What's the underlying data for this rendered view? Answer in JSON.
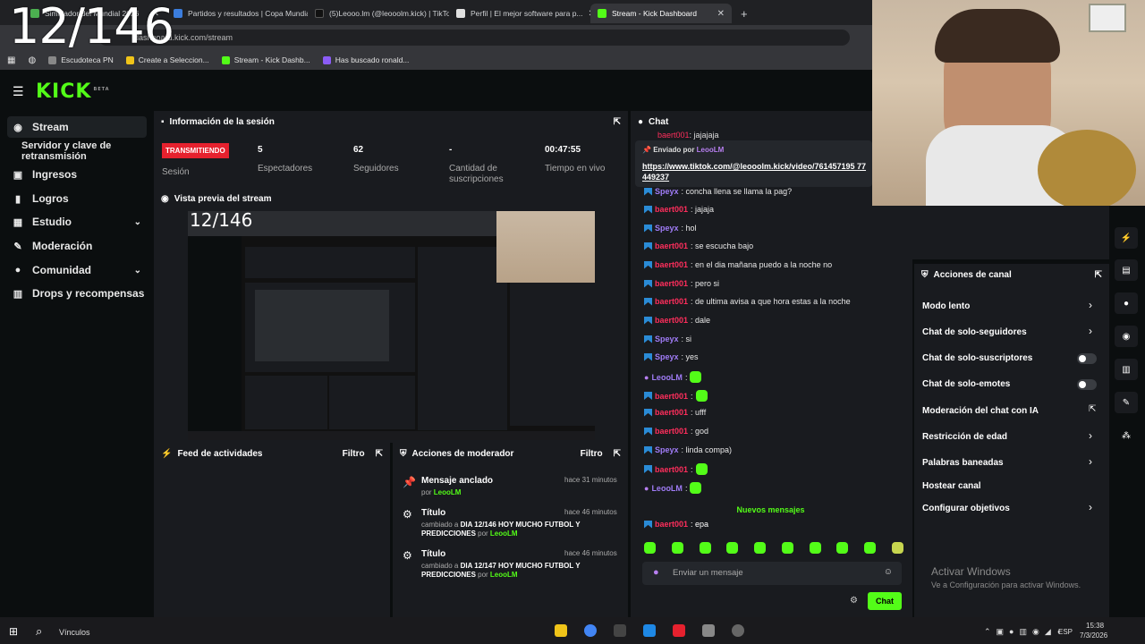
{
  "overlay": {
    "counter": "12/146"
  },
  "browser": {
    "tabs": [
      {
        "label": "Simulador del Mundial 2026",
        "color": "#4caf50"
      },
      {
        "label": "Partidos y resultados | Copa Mundial",
        "color": "#3b7ddd"
      },
      {
        "label": "(5)Leooo.lm (@leooolm.kick) | TikTok",
        "color": "#111111"
      },
      {
        "label": "Perfil | El mejor software para p...",
        "color": "#e0e0e0"
      },
      {
        "label": "Stream - Kick Dashboard",
        "color": "#53fc18"
      }
    ],
    "new_tab": "+",
    "close": "✕",
    "address": "dashboard.kick.com/stream",
    "bookmarks": [
      {
        "label": "Escudoteca PN",
        "color": "#888888"
      },
      {
        "label": "Create a Seleccion...",
        "color": "#f0c419"
      },
      {
        "label": "Stream - Kick Dashb...",
        "color": "#53fc18"
      },
      {
        "label": "Has buscado ronald...",
        "color": "#8b5cf6"
      }
    ]
  },
  "kick": {
    "logo": "KICK",
    "logo_sup": "BETA",
    "sidebar": [
      {
        "label": "Stream",
        "icon": "dot-icon",
        "glyph": "((·))"
      },
      {
        "label": "Servidor y clave de retransmisión",
        "icon": "",
        "glyph": ""
      },
      {
        "label": "Ingresos",
        "icon": "wallet-icon",
        "glyph": "▪"
      },
      {
        "label": "Logros",
        "icon": "chart-icon",
        "glyph": "▮"
      },
      {
        "label": "Estudio",
        "icon": "grid-icon",
        "glyph": "▦"
      },
      {
        "label": "Moderación",
        "icon": "wrench-icon",
        "glyph": "✎"
      },
      {
        "label": "Comunidad",
        "icon": "people-icon",
        "glyph": "●"
      },
      {
        "label": "Drops y recompensas",
        "icon": "gift-icon",
        "glyph": "▥"
      }
    ],
    "session": {
      "title": "Información de la sesión",
      "badge": "TRANSMITIENDO",
      "labels": [
        "Sesión",
        "Espectadores",
        "Seguidores",
        "Cantidad de suscripciones",
        "Tiempo en vivo"
      ],
      "values": [
        "5",
        "62",
        "-",
        "00:47:55"
      ]
    },
    "preview": {
      "title": "Vista previa del stream",
      "counter": "12/146"
    },
    "activity": {
      "title": "Feed de actividades",
      "filter": "Filtro"
    },
    "mod_actions": {
      "title": "Acciones de moderador",
      "filter": "Filtro",
      "items": [
        {
          "title": "Mensaje anclado",
          "by": "por",
          "user": "LeooLM",
          "detail": "",
          "time": "hace 31 minutos"
        },
        {
          "title": "Título",
          "by": "cambiado a",
          "user": "LeooLM",
          "detail": "DIA 12/146 HOY MUCHO FUTBOL Y PREDICCIONES",
          "time": "hace 46 minutos"
        },
        {
          "title": "Título",
          "by": "cambiado a",
          "user": "LeooLM",
          "detail": "DIA 12/147 HOY MUCHO FUTBOL Y PREDICCIONES",
          "time": "hace 46 minutos"
        }
      ]
    },
    "chat": {
      "title": "Chat",
      "pinned_by_label": "Enviado por",
      "pinned_user": "LeooLM",
      "pinned_link": "https://www.tiktok.com/@leooolm.kick/video/761457195 77449237",
      "first_line": ": jajajaja",
      "messages": [
        {
          "user": "Speyx",
          "text": ": concha llena se llama la pag?"
        },
        {
          "user": "baert001",
          "text": ": jajaja"
        },
        {
          "user": "Speyx",
          "text": ": hol"
        },
        {
          "user": "baert001",
          "text": ": se escucha bajo"
        },
        {
          "user": "baert001",
          "text": ": en el dia mañana puedo a la noche no"
        },
        {
          "user": "baert001",
          "text": ": pero si"
        },
        {
          "user": "baert001",
          "text": ": de ultima avisa a que hora estas a la noche"
        },
        {
          "user": "baert001",
          "text": ": dale"
        },
        {
          "user": "Speyx",
          "text": ": si"
        },
        {
          "user": "Speyx",
          "text": ": yes"
        },
        {
          "user": "LeooLM",
          "text": ":"
        },
        {
          "user": "baert001",
          "text": ":"
        },
        {
          "user": "baert001",
          "text": ": ufff"
        },
        {
          "user": "baert001",
          "text": ": god"
        },
        {
          "user": "Speyx",
          "text": ": linda compa)"
        },
        {
          "user": "baert001",
          "text": ":"
        },
        {
          "user": "LeooLM",
          "text": ":"
        }
      ],
      "new_messages": "Nuevos mensajes",
      "last": {
        "user": "baert001",
        "text": ": epa"
      },
      "input_placeholder": "Enviar un mensaje",
      "send": "Chat"
    },
    "channel_actions": {
      "title": "Acciones de canal",
      "items": [
        {
          "label": "Modo lento",
          "control": "chevron"
        },
        {
          "label": "Chat de solo-seguidores",
          "control": "chevron"
        },
        {
          "label": "Chat de solo-suscriptores",
          "control": "toggle"
        },
        {
          "label": "Chat de solo-emotes",
          "control": "toggle"
        },
        {
          "label": "Moderación del chat con IA",
          "control": "external"
        },
        {
          "label": "Restricción de edad",
          "control": "chevron"
        },
        {
          "label": "Palabras baneadas",
          "control": "chevron"
        },
        {
          "label": "Hostear canal",
          "control": "none"
        },
        {
          "label": "Configurar objetivos",
          "control": "chevron"
        }
      ]
    }
  },
  "windows": {
    "activate_title": "Activar Windows",
    "activate_sub": "Ve a Configuración para activar Windows.",
    "search": "Vínculos",
    "lang": "ESP",
    "time": "15:38",
    "date": "7/3/2026"
  },
  "colors": {
    "accent": "#53fc18",
    "live": "#e6212e",
    "panel": "#191b1f",
    "bg": "#0b0e0f"
  }
}
